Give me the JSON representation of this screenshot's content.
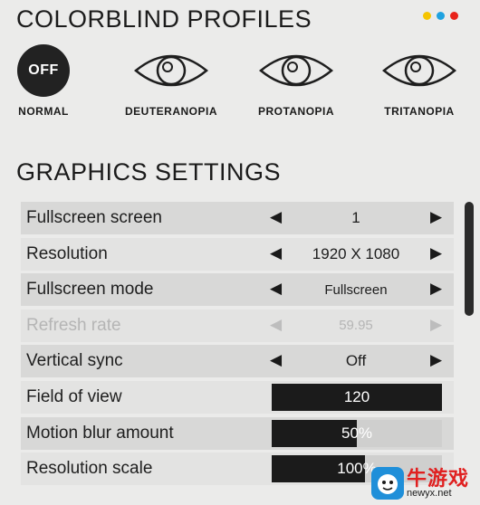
{
  "header": {
    "profiles_title": "COLORBLIND PROFILES",
    "dot_colors": [
      "#f5c400",
      "#1fa2e0",
      "#e8231b"
    ]
  },
  "profiles": [
    {
      "icon": "off-badge",
      "badge_text": "OFF",
      "label": "NORMAL",
      "selected": true
    },
    {
      "icon": "eye-icon",
      "label": "DEUTERANOPIA",
      "selected": false
    },
    {
      "icon": "eye-icon",
      "label": "PROTANOPIA",
      "selected": false
    },
    {
      "icon": "eye-icon",
      "label": "TRITANOPIA",
      "selected": false
    }
  ],
  "graphics": {
    "title": "GRAPHICS SETTINGS",
    "rows": [
      {
        "label": "Fullscreen screen",
        "type": "selector",
        "value": "1"
      },
      {
        "label": "Resolution",
        "type": "selector",
        "value": "1920 X 1080"
      },
      {
        "label": "Fullscreen mode",
        "type": "selector",
        "value": "Fullscreen"
      },
      {
        "label": "Refresh rate",
        "type": "selector",
        "value": "59.95",
        "disabled": true
      },
      {
        "label": "Vertical sync",
        "type": "selector",
        "value": "Off"
      },
      {
        "label": "Field of view",
        "type": "slider",
        "value": "120",
        "fill_fraction": 1.0
      },
      {
        "label": "Motion blur amount",
        "type": "slider",
        "value": "50%",
        "fill_fraction": 0.5
      },
      {
        "label": "Resolution scale",
        "type": "slider",
        "value": "100%",
        "fill_fraction": 0.55
      }
    ]
  },
  "watermark": {
    "brand": "牛游戏",
    "url": "newyx.net"
  }
}
